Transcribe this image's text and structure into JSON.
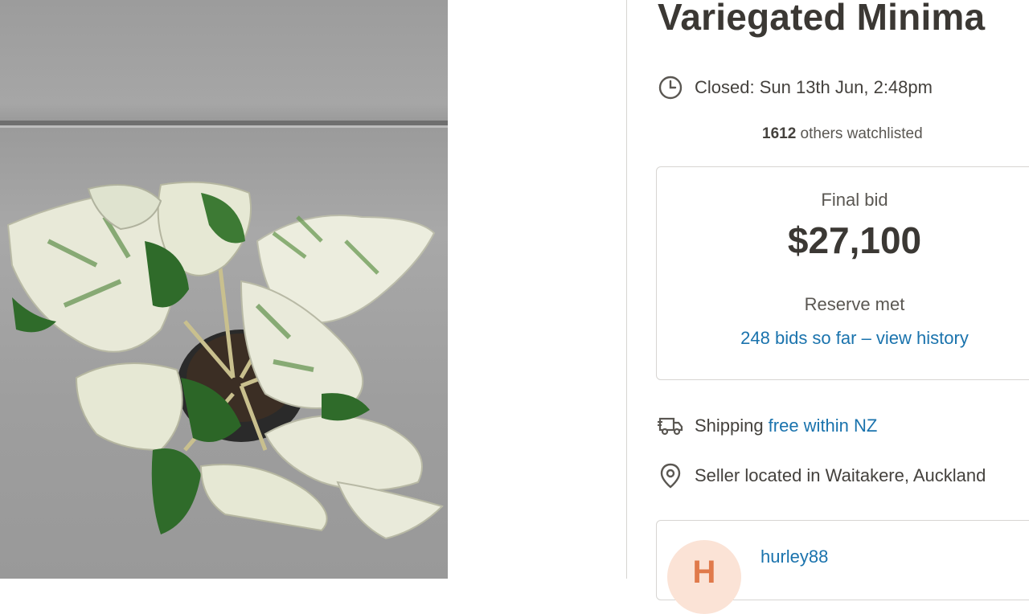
{
  "listing": {
    "title": "Variegated Minima",
    "closed_text": "Closed: Sun 13th Jun, 2:48pm",
    "watch_count": "1612",
    "watch_suffix": " others watchlisted"
  },
  "bid": {
    "label": "Final bid",
    "amount": "$27,100",
    "reserve": "Reserve met",
    "history_link": "248 bids so far – view history"
  },
  "shipping": {
    "label": "Shipping",
    "link": "free within NZ"
  },
  "location": {
    "text": "Seller located in Waitakere, Auckland"
  },
  "seller": {
    "initial": "H",
    "name": "hurley88"
  },
  "icons": {
    "clock": "clock-icon",
    "truck": "delivery-truck-icon",
    "pin": "location-pin-icon"
  },
  "colors": {
    "link": "#1a73ad",
    "text": "#44413d",
    "avatar_bg": "#fbe3d6",
    "avatar_fg": "#e07a4b"
  }
}
